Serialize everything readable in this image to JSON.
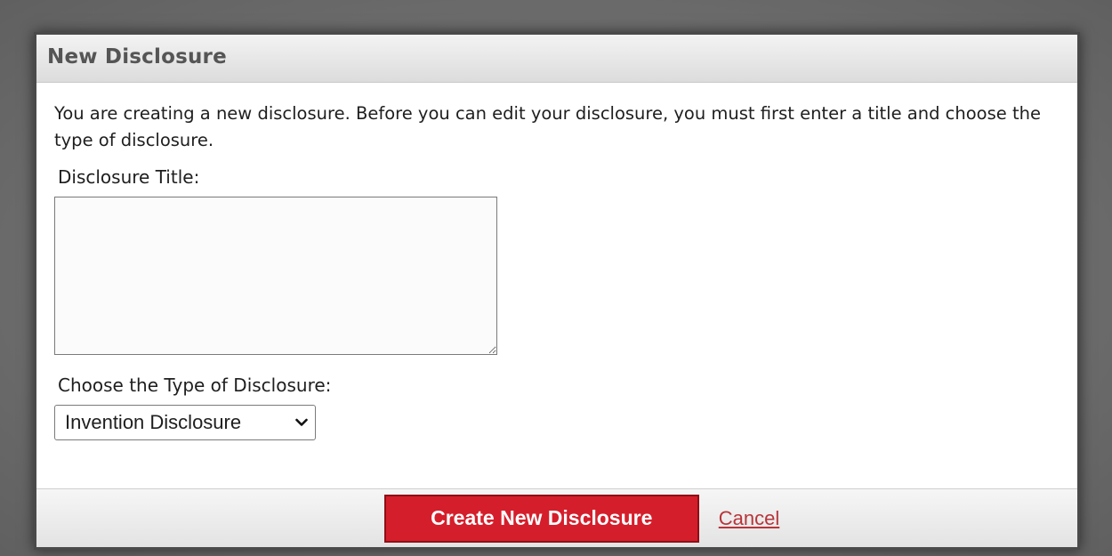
{
  "dialog": {
    "title": "New Disclosure",
    "intro": "You are creating a new disclosure. Before you can edit your disclosure, you must first enter a title and choose the type of disclosure."
  },
  "form": {
    "title_label": "Disclosure Title:",
    "title_value": "",
    "type_label": "Choose the Type of Disclosure:",
    "type_selected": "Invention Disclosure"
  },
  "footer": {
    "create_label": "Create New Disclosure",
    "cancel_label": "Cancel"
  },
  "colors": {
    "accent": "#d51e2b",
    "link": "#b8353a"
  },
  "icons": {
    "select_arrow": "chevron-down-icon"
  }
}
